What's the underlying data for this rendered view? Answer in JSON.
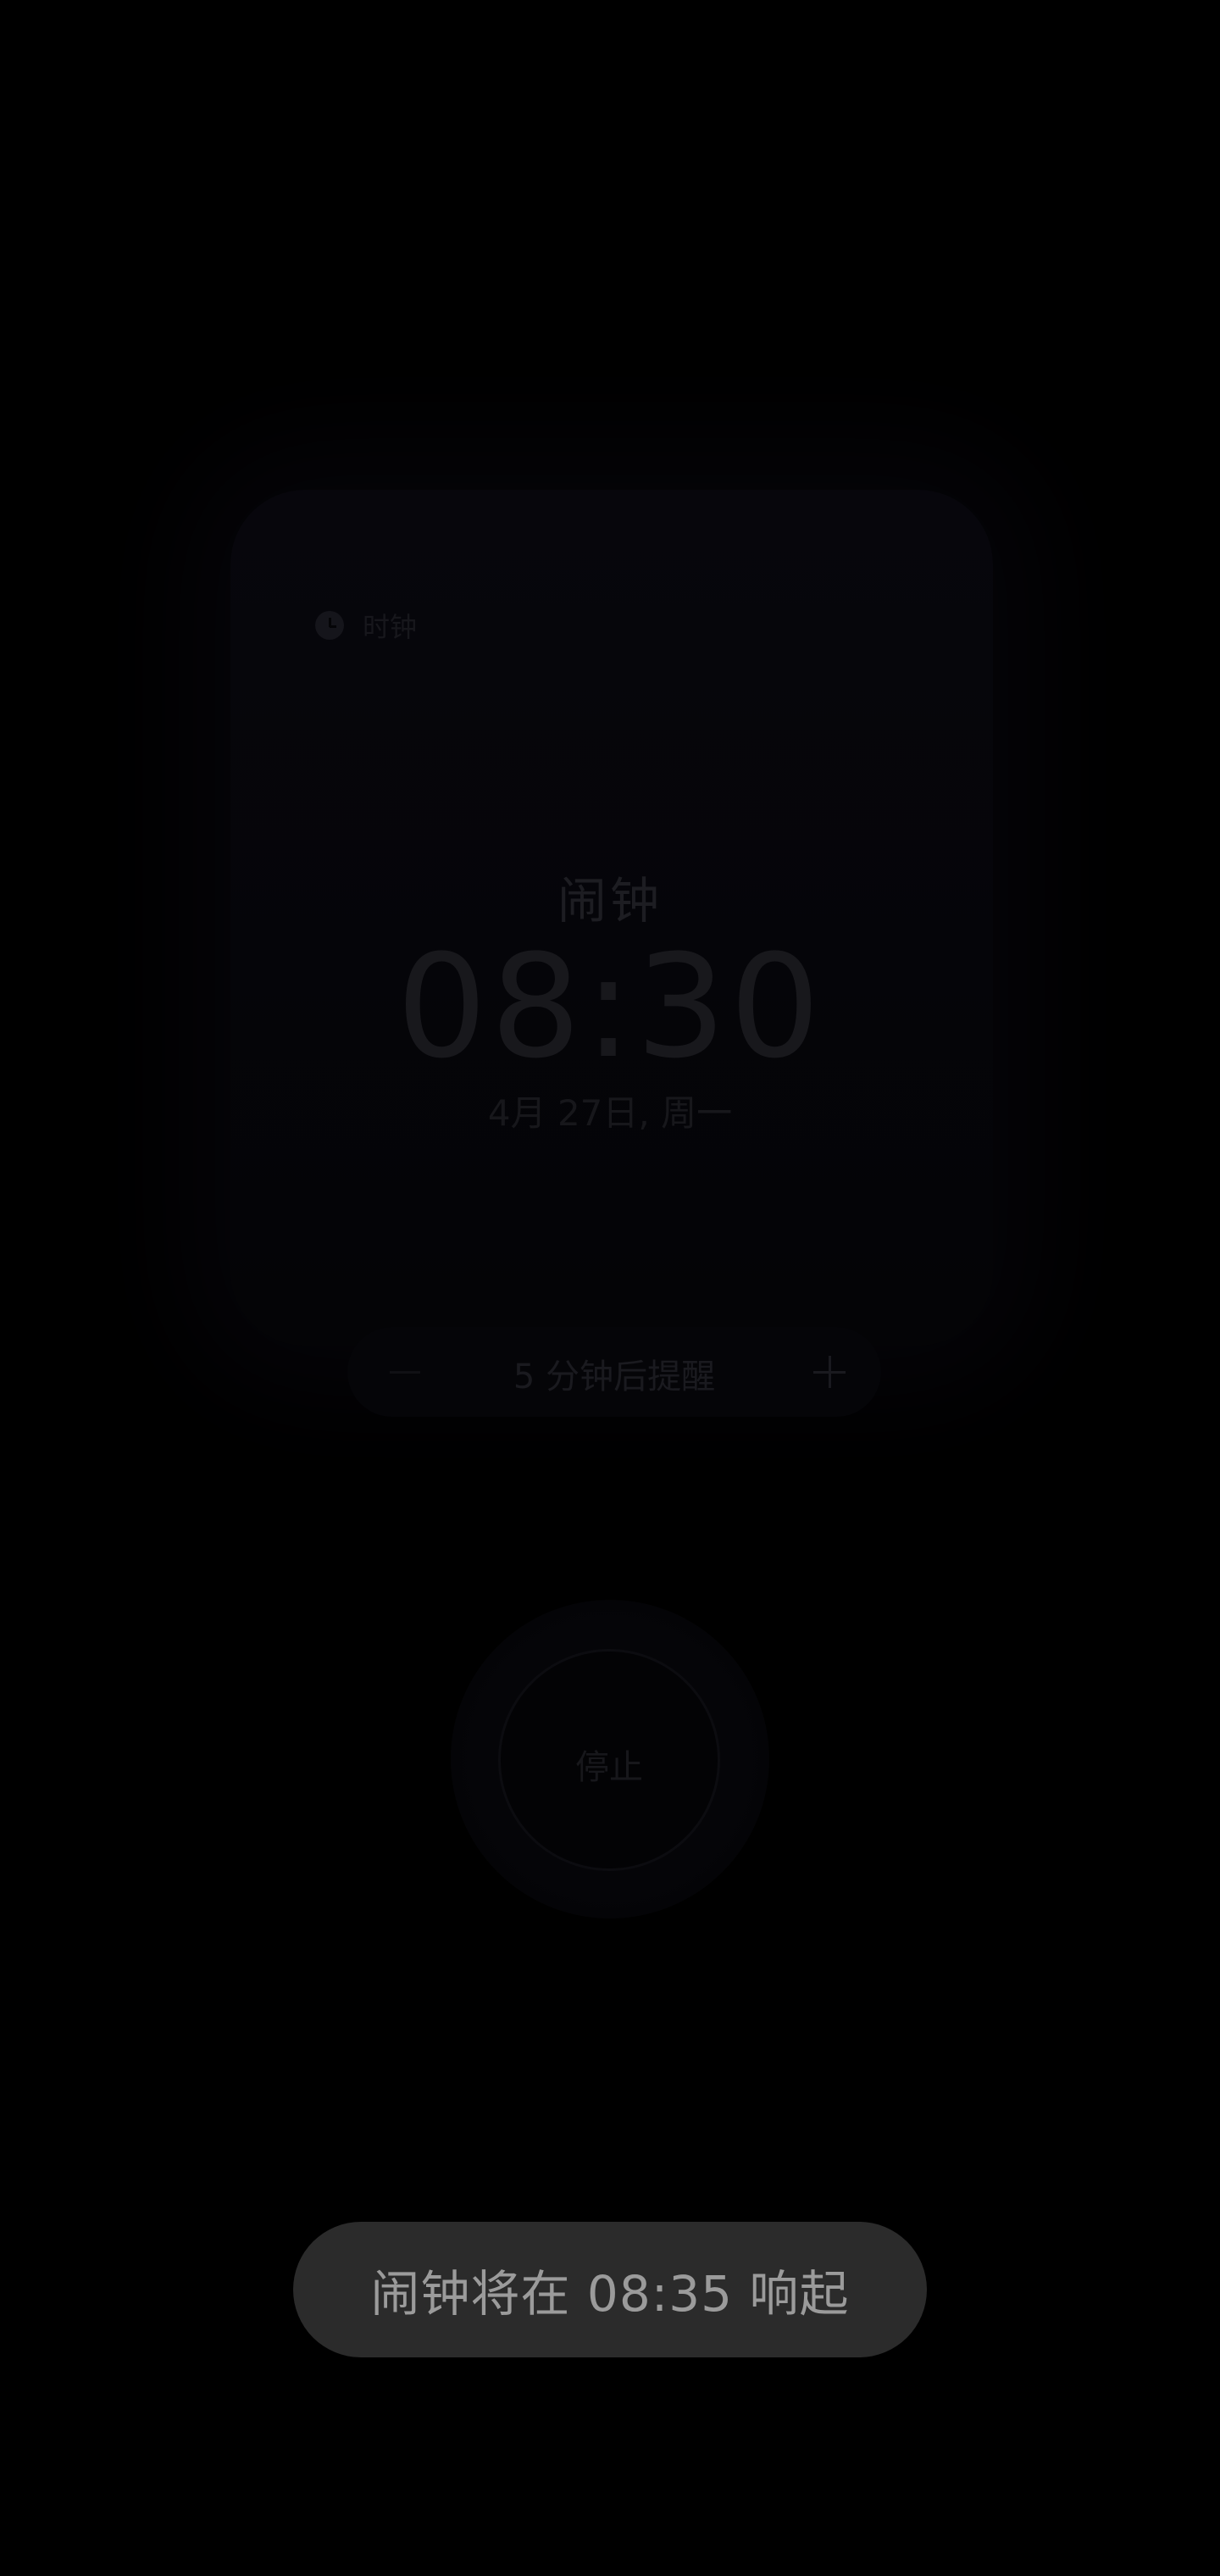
{
  "app": {
    "name": "时钟",
    "icon": "clock-icon"
  },
  "alarm": {
    "title": "闹钟",
    "time": "08:30",
    "date": "4月 27日, 周一"
  },
  "snooze": {
    "minus_icon": "minus-icon",
    "label": "5 分钟后提醒",
    "plus_icon": "plus-icon"
  },
  "stop": {
    "label": "停止"
  },
  "toast": {
    "text": "闹钟将在 08:35 响起"
  },
  "colors": {
    "background": "#000000",
    "toast_background": "#2b2b2b",
    "toast_text": "#9b9b9b"
  }
}
